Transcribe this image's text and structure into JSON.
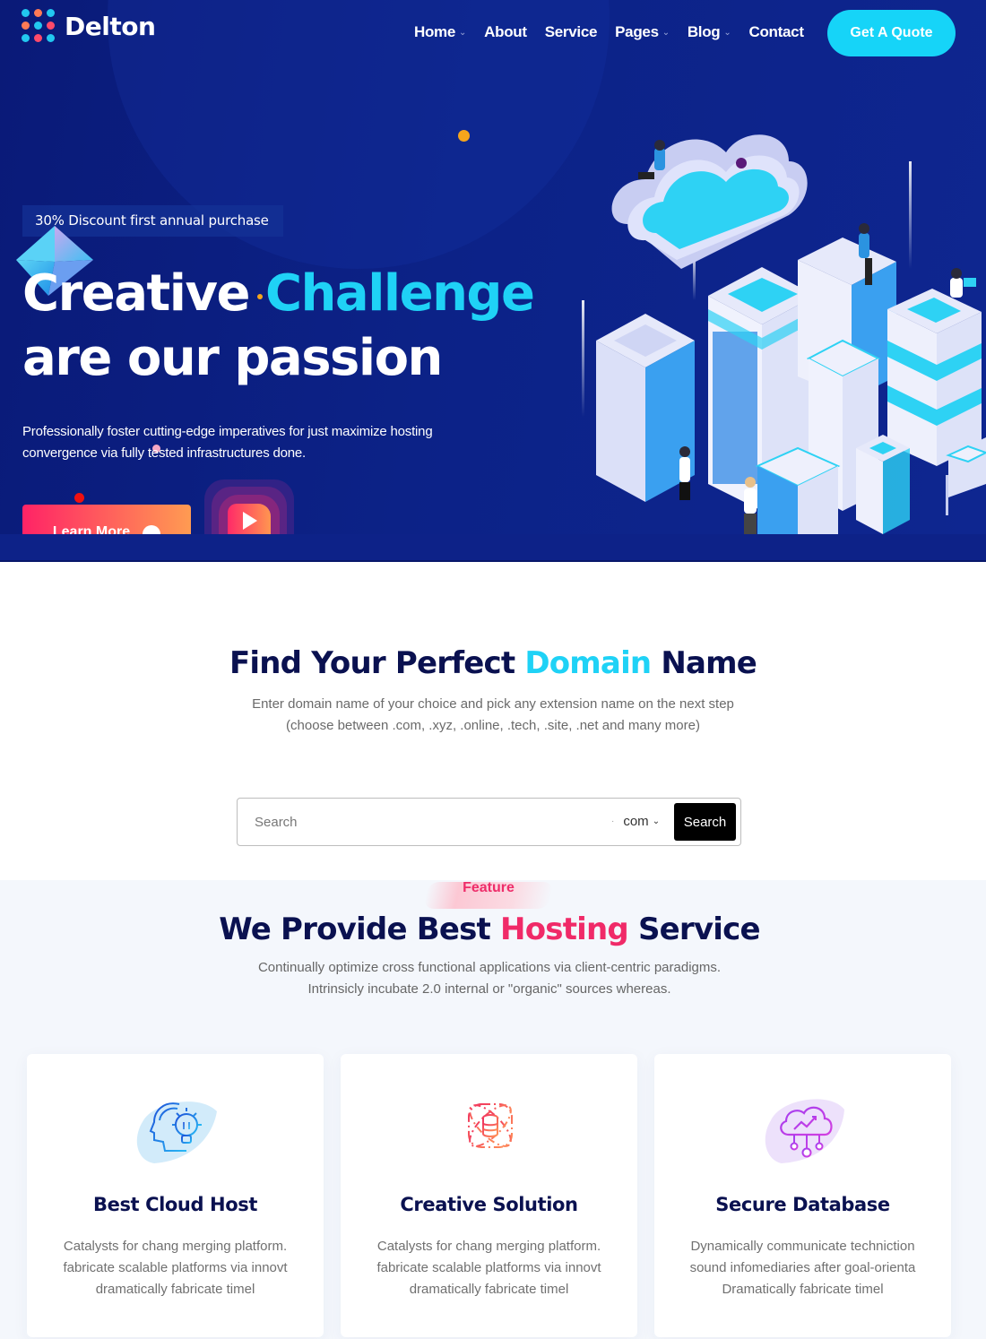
{
  "brand": {
    "name": "Delton"
  },
  "nav": {
    "items": [
      {
        "label": "Home",
        "has_dropdown": true
      },
      {
        "label": "About",
        "has_dropdown": false
      },
      {
        "label": "Service",
        "has_dropdown": false
      },
      {
        "label": "Pages",
        "has_dropdown": true
      },
      {
        "label": "Blog",
        "has_dropdown": true
      },
      {
        "label": "Contact",
        "has_dropdown": false
      }
    ],
    "cta_label": "Get A Quote",
    "dropdown_icon": "chevron-down-icon"
  },
  "hero": {
    "badge": "30% Discount first annual purchase",
    "title_part1": "Creative ",
    "title_accent": "Challenge",
    "title_line2": "are our passion",
    "description": "Professionally foster cutting-edge imperatives for just maximize hosting convergence via fully tested infrastructures done.",
    "learn_more_label": "Learn More",
    "learn_more_icon": "arrow-right-icon",
    "play_icon": "play-icon",
    "illustration": "isometric-cloud-servers-illustration"
  },
  "domain": {
    "title_part1": "Find Your Perfect ",
    "title_accent": "Domain",
    "title_part2": " Name",
    "subtitle_line1": "Enter domain name of your choice and pick any extension name on the next step",
    "subtitle_line2": "(choose between .com, .xyz, .online, .tech, .site, .net and many more)",
    "search_placeholder": "Search",
    "search_value": "",
    "extension_selected": "com",
    "search_button_label": "Search"
  },
  "features": {
    "tag": "Feature",
    "title_part1": "We Provide Best ",
    "title_accent": "Hosting",
    "title_part2": " Service",
    "subtitle_line1": "Continually optimize cross functional applications via client-centric paradigms.",
    "subtitle_line2": "Intrinsicly incubate 2.0 internal or \"organic\" sources whereas.",
    "cards": [
      {
        "icon": "head-lightbulb-icon",
        "title": "Best Cloud Host",
        "lines": [
          "Catalysts for chang merging platform.",
          "fabricate scalable platforms via innovt",
          "dramatically fabricate timel"
        ]
      },
      {
        "icon": "database-orbit-icon",
        "title": "Creative Solution",
        "lines": [
          "Catalysts for chang merging platform.",
          "fabricate scalable platforms via innovt",
          "dramatically fabricate timel"
        ]
      },
      {
        "icon": "cloud-network-icon",
        "title": "Secure Database",
        "lines": [
          "Dynamically communicate techniction",
          "sound infomediaries after goal-orienta",
          "Dramatically fabricate timel"
        ]
      }
    ]
  },
  "colors": {
    "hero_bg": "#0c2287",
    "accent_cyan": "#1fd2f6",
    "accent_pink": "#f02a68",
    "heading_navy": "#0a1150",
    "cta_gradient_start": "#ff2366",
    "cta_gradient_end": "#ff9b52"
  }
}
